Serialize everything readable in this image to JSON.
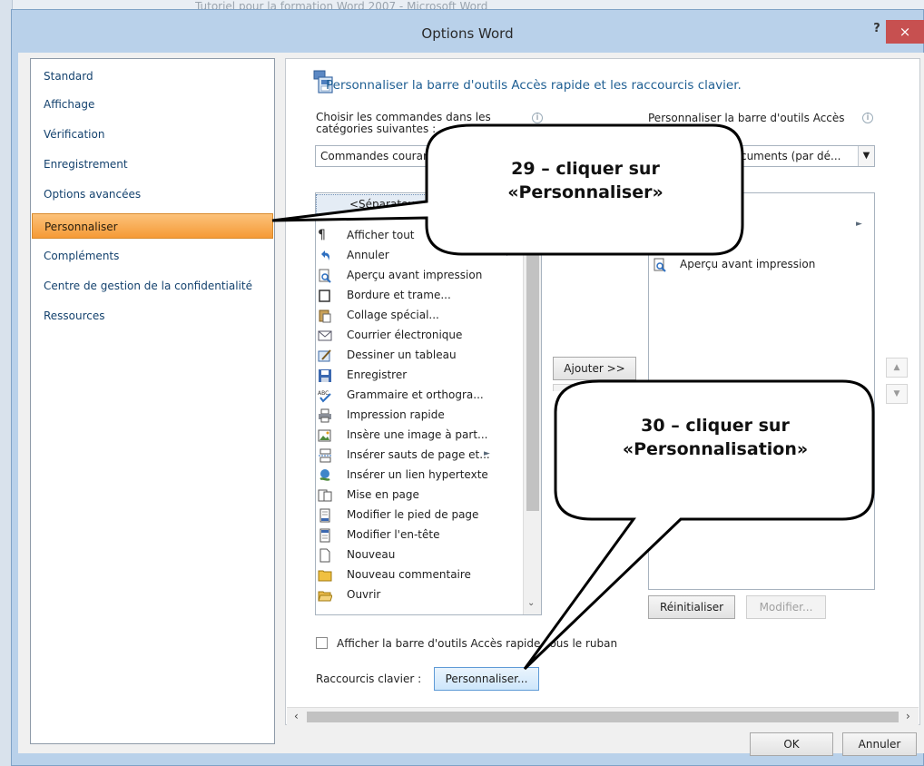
{
  "background": {
    "window_title": "Tutoriel pour la formation Word 2007 - Microsoft Word"
  },
  "dialog": {
    "title": "Options Word",
    "help_label": "?",
    "close_label": "×"
  },
  "nav": {
    "items": [
      {
        "label": "Standard"
      },
      {
        "label": "Affichage"
      },
      {
        "label": "Vérification"
      },
      {
        "label": "Enregistrement"
      },
      {
        "label": "Options avancées"
      },
      {
        "label": "Personnaliser",
        "selected": true
      },
      {
        "label": "Compléments"
      },
      {
        "label": "Centre de gestion de la confidentialité"
      },
      {
        "label": "Ressources"
      }
    ]
  },
  "panel": {
    "header": "Personnaliser la barre d'outils Accès rapide et les raccourcis clavier.",
    "choose_label_line1": "Choisir les commandes dans les",
    "choose_label_line2": "catégories suivantes :",
    "choose_combo_value": "Commandes courantes",
    "customize_label": "Personnaliser la barre d'outils Accès",
    "customize_combo_value": "Pour tous les documents (par dé...",
    "info_glyph": "i",
    "commands": [
      {
        "label": "<Séparateur>",
        "icon": "separator-icon"
      },
      {
        "label": "Afficher tout",
        "icon": "pilcrow-icon"
      },
      {
        "label": "Annuler",
        "icon": "undo-icon"
      },
      {
        "label": "Aperçu avant impression",
        "icon": "print-preview-icon"
      },
      {
        "label": "Bordure et trame...",
        "icon": "border-icon"
      },
      {
        "label": "Collage spécial...",
        "icon": "paste-special-icon"
      },
      {
        "label": "Courrier électronique",
        "icon": "email-icon"
      },
      {
        "label": "Dessiner un tableau",
        "icon": "draw-table-icon"
      },
      {
        "label": "Enregistrer",
        "icon": "save-icon"
      },
      {
        "label": "Grammaire et orthogra...",
        "icon": "spelling-icon"
      },
      {
        "label": "Impression rapide",
        "icon": "quick-print-icon"
      },
      {
        "label": "Insère une image à part...",
        "icon": "insert-picture-icon"
      },
      {
        "label": "Insérer sauts de page et...",
        "icon": "page-break-icon"
      },
      {
        "label": "Insérer un lien hypertexte",
        "icon": "hyperlink-icon"
      },
      {
        "label": "Mise en page",
        "icon": "page-setup-icon"
      },
      {
        "label": "Modifier le pied de page",
        "icon": "footer-icon"
      },
      {
        "label": "Modifier l'en-tête",
        "icon": "header-icon"
      },
      {
        "label": "Nouveau",
        "icon": "new-document-icon"
      },
      {
        "label": "Nouveau commentaire",
        "icon": "new-comment-icon"
      },
      {
        "label": "Ouvrir",
        "icon": "open-folder-icon"
      }
    ],
    "toolbar_items": [
      {
        "label": "Aperçu avant impression",
        "icon": "print-preview-icon"
      }
    ],
    "add_button": "Ajouter >>",
    "reset_button": "Réinitialiser",
    "modify_button": "Modifier...",
    "show_below_ribbon_label": "Afficher la barre d'outils Accès rapide sous le ruban",
    "shortcuts_label": "Raccourcis clavier :",
    "shortcuts_button": "Personnaliser..."
  },
  "footer": {
    "ok_button": "OK",
    "cancel_button": "Annuler"
  },
  "callouts": {
    "first": {
      "line1": "29 – cliquer sur",
      "line2": "«Personnaliser»"
    },
    "second": {
      "line1": "30 – cliquer sur",
      "line2": "«Personnalisation»"
    }
  },
  "colors": {
    "selected_nav": "#f59a36",
    "header_text": "#1f5f93",
    "close_button": "#c75050"
  }
}
